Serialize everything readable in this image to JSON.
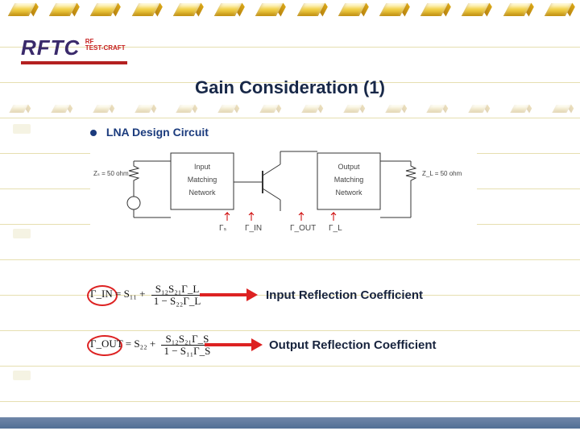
{
  "logo": {
    "main": "RFTC",
    "tag_line1": "RF",
    "tag_line2": "TEST-CRAFT"
  },
  "title": "Gain Consideration (1)",
  "section_heading": "LNA Design Circuit",
  "circuit": {
    "zs_label": "Zₛ = 50 ohm",
    "input_block_l1": "Input",
    "input_block_l2": "Matching",
    "input_block_l3": "Network",
    "output_block_l1": "Output",
    "output_block_l2": "Matching",
    "output_block_l3": "Network",
    "zl_label": "Z_L = 50 ohm",
    "gamma_s": "Γₛ",
    "gamma_in": "Γ_IN",
    "gamma_out": "Γ_OUT",
    "gamma_l": "Γ_L"
  },
  "eq_in": {
    "lhs": "Γ_IN",
    "rhs_lead": " = S₁₁ + ",
    "num": "S₁₂S₂₁Γ_L",
    "den": "1 − S₂₂Γ_L",
    "label": "Input Reflection Coefficient"
  },
  "eq_out": {
    "lhs": "Γ_OUT",
    "rhs_lead": " = S₂₂ + ",
    "num": "S₁₂S₂₁Γ_S",
    "den": "1 − S₁₁Γ_S",
    "label": "Output Reflection Coefficient"
  }
}
